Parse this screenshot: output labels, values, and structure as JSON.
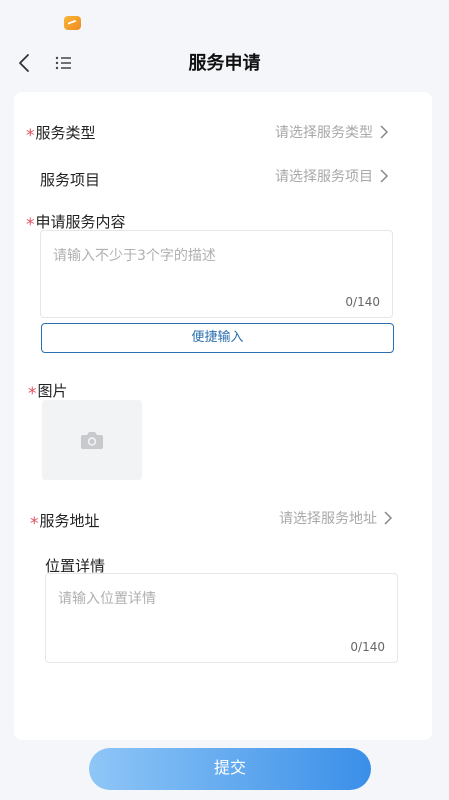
{
  "header": {
    "title": "服务申请"
  },
  "form": {
    "service_type": {
      "label": "服务类型",
      "placeholder": "请选择服务类型"
    },
    "service_item": {
      "label": "服务项目",
      "placeholder": "请选择服务项目"
    },
    "content": {
      "label": "申请服务内容",
      "placeholder": "请输入不少于3个字的描述",
      "count": "0/140"
    },
    "quick_input_label": "便捷输入",
    "images": {
      "label": "图片"
    },
    "address": {
      "label": "服务地址",
      "placeholder": "请选择服务地址"
    },
    "location": {
      "label": "位置详情",
      "placeholder": "请输入位置详情",
      "count": "0/140"
    },
    "required_mark": "*"
  },
  "submit_label": "提交",
  "colors": {
    "accent": "#3a8fe8",
    "required": "#e0525e",
    "quick_border": "#2a6fb0"
  }
}
